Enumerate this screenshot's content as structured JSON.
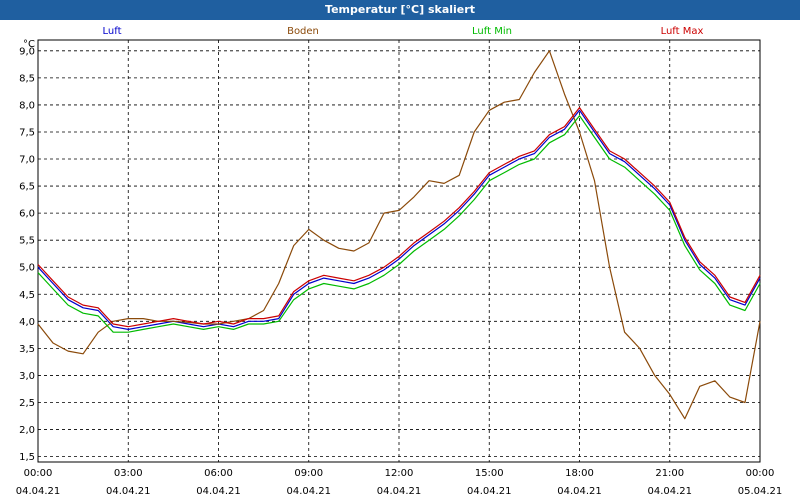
{
  "window": {
    "title": "Temperatur [°C] skaliert"
  },
  "chart_data": {
    "type": "line",
    "title": "Temperatur [°C] skaliert",
    "ylabel": "°C",
    "ylim": [
      1.4,
      9.2
    ],
    "yticks": [
      "1,5",
      "2,0",
      "2,5",
      "3,0",
      "3,5",
      "4,0",
      "4,5",
      "5,0",
      "5,5",
      "6,0",
      "6,5",
      "7,0",
      "7,5",
      "8,0",
      "8,5",
      "9,0"
    ],
    "xticks": [
      {
        "time": "00:00",
        "date": "04.04.21"
      },
      {
        "time": "03:00",
        "date": "04.04.21"
      },
      {
        "time": "06:00",
        "date": "04.04.21"
      },
      {
        "time": "09:00",
        "date": "04.04.21"
      },
      {
        "time": "12:00",
        "date": "04.04.21"
      },
      {
        "time": "15:00",
        "date": "04.04.21"
      },
      {
        "time": "18:00",
        "date": "04.04.21"
      },
      {
        "time": "21:00",
        "date": "04.04.21"
      },
      {
        "time": "00:00",
        "date": "05.04.21"
      }
    ],
    "grid": true,
    "legend_position": "top",
    "x_hours": [
      0,
      0.5,
      1,
      1.5,
      2,
      2.5,
      3,
      3.5,
      4,
      4.5,
      5,
      5.5,
      6,
      6.5,
      7,
      7.5,
      8,
      8.5,
      9,
      9.5,
      10,
      10.5,
      11,
      11.5,
      12,
      12.5,
      13,
      13.5,
      14,
      14.5,
      15,
      15.5,
      16,
      16.5,
      17,
      17.5,
      18,
      18.5,
      19,
      19.5,
      20,
      20.5,
      21,
      21.5,
      22,
      22.5,
      23,
      23.5,
      24
    ],
    "series": [
      {
        "name": "Luft",
        "color": "#0000cc",
        "values": [
          5.0,
          4.7,
          4.4,
          4.25,
          4.2,
          3.9,
          3.85,
          3.9,
          3.95,
          4.0,
          3.95,
          3.9,
          3.95,
          3.9,
          4.0,
          4.0,
          4.05,
          4.5,
          4.7,
          4.8,
          4.75,
          4.7,
          4.8,
          4.95,
          5.15,
          5.4,
          5.6,
          5.8,
          6.05,
          6.35,
          6.7,
          6.85,
          7.0,
          7.1,
          7.4,
          7.55,
          7.9,
          7.5,
          7.1,
          6.95,
          6.7,
          6.45,
          6.15,
          5.5,
          5.05,
          4.8,
          4.4,
          4.3,
          4.8
        ]
      },
      {
        "name": "Boden",
        "color": "#8b4a0a",
        "values": [
          3.95,
          3.6,
          3.45,
          3.4,
          3.8,
          4.0,
          4.05,
          4.05,
          4.0,
          4.0,
          3.98,
          3.95,
          3.95,
          4.0,
          4.05,
          4.2,
          4.7,
          5.4,
          5.7,
          5.5,
          5.35,
          5.3,
          5.45,
          6.0,
          6.05,
          6.3,
          6.6,
          6.55,
          6.7,
          7.5,
          7.9,
          8.05,
          8.1,
          8.6,
          9.0,
          8.2,
          7.5,
          6.6,
          5.0,
          3.8,
          3.5,
          3.0,
          2.65,
          2.2,
          2.8,
          2.9,
          2.6,
          2.5,
          4.0
        ]
      },
      {
        "name": "Luft Min",
        "color": "#00bb00",
        "values": [
          4.9,
          4.6,
          4.3,
          4.15,
          4.1,
          3.8,
          3.8,
          3.85,
          3.9,
          3.95,
          3.9,
          3.85,
          3.9,
          3.85,
          3.95,
          3.95,
          4.0,
          4.4,
          4.6,
          4.7,
          4.65,
          4.6,
          4.7,
          4.85,
          5.05,
          5.3,
          5.5,
          5.7,
          5.95,
          6.25,
          6.6,
          6.75,
          6.9,
          7.0,
          7.3,
          7.45,
          7.8,
          7.4,
          7.0,
          6.85,
          6.6,
          6.35,
          6.05,
          5.4,
          4.95,
          4.7,
          4.3,
          4.2,
          4.7
        ]
      },
      {
        "name": "Luft Max",
        "color": "#cc0000",
        "values": [
          5.05,
          4.75,
          4.45,
          4.3,
          4.25,
          3.95,
          3.9,
          3.95,
          4.0,
          4.05,
          4.0,
          3.95,
          4.0,
          3.95,
          4.05,
          4.05,
          4.1,
          4.55,
          4.75,
          4.85,
          4.8,
          4.75,
          4.85,
          5.0,
          5.2,
          5.45,
          5.65,
          5.85,
          6.1,
          6.4,
          6.75,
          6.9,
          7.05,
          7.15,
          7.45,
          7.6,
          7.95,
          7.55,
          7.15,
          7.0,
          6.75,
          6.5,
          6.2,
          5.55,
          5.1,
          4.85,
          4.45,
          4.35,
          4.85
        ]
      }
    ]
  }
}
